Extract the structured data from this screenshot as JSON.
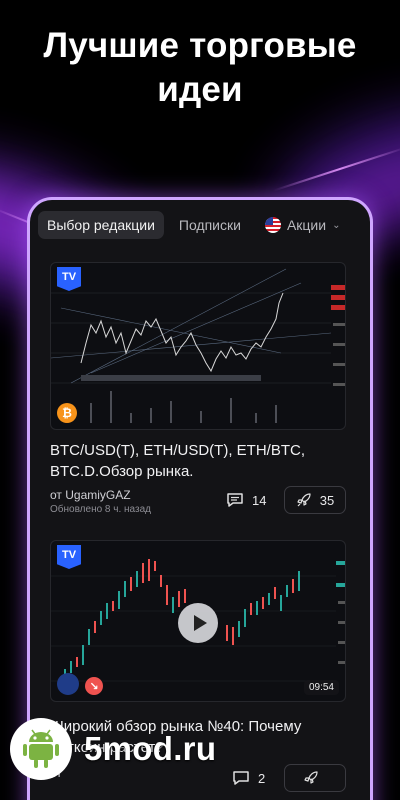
{
  "headline": [
    "Лучшие торговые",
    "идеи"
  ],
  "tabs": [
    {
      "label": "Выбор редакции",
      "active": true
    },
    {
      "label": "Подписки",
      "active": false
    },
    {
      "label": "Акции",
      "active": false
    }
  ],
  "ideas": [
    {
      "title": "BTC/USD(T), ETH/USD(T), ETH/BTC, BTC.D.Обзор рынка.",
      "author": "от UgamiyGAZ",
      "updated": "Обновлено 8 ч. назад",
      "comments": "14",
      "boosts": "35",
      "badge": "TV",
      "coin_symbol": "₿"
    },
    {
      "title": "Широкий обзор рынка №40: Почему биткоин растет?",
      "author": "от",
      "comments": "2",
      "boosts": "",
      "badge": "TV",
      "duration": "09:54"
    }
  ],
  "brand": {
    "name": "5mod.ru"
  },
  "colors": {
    "accent": "#2962ff",
    "glow": "#b02cf0",
    "card_bg": "#131316",
    "up": "#26a69a",
    "down": "#ef5350"
  },
  "icons": [
    "comment-icon",
    "rocket-icon",
    "play-icon",
    "android-icon"
  ]
}
